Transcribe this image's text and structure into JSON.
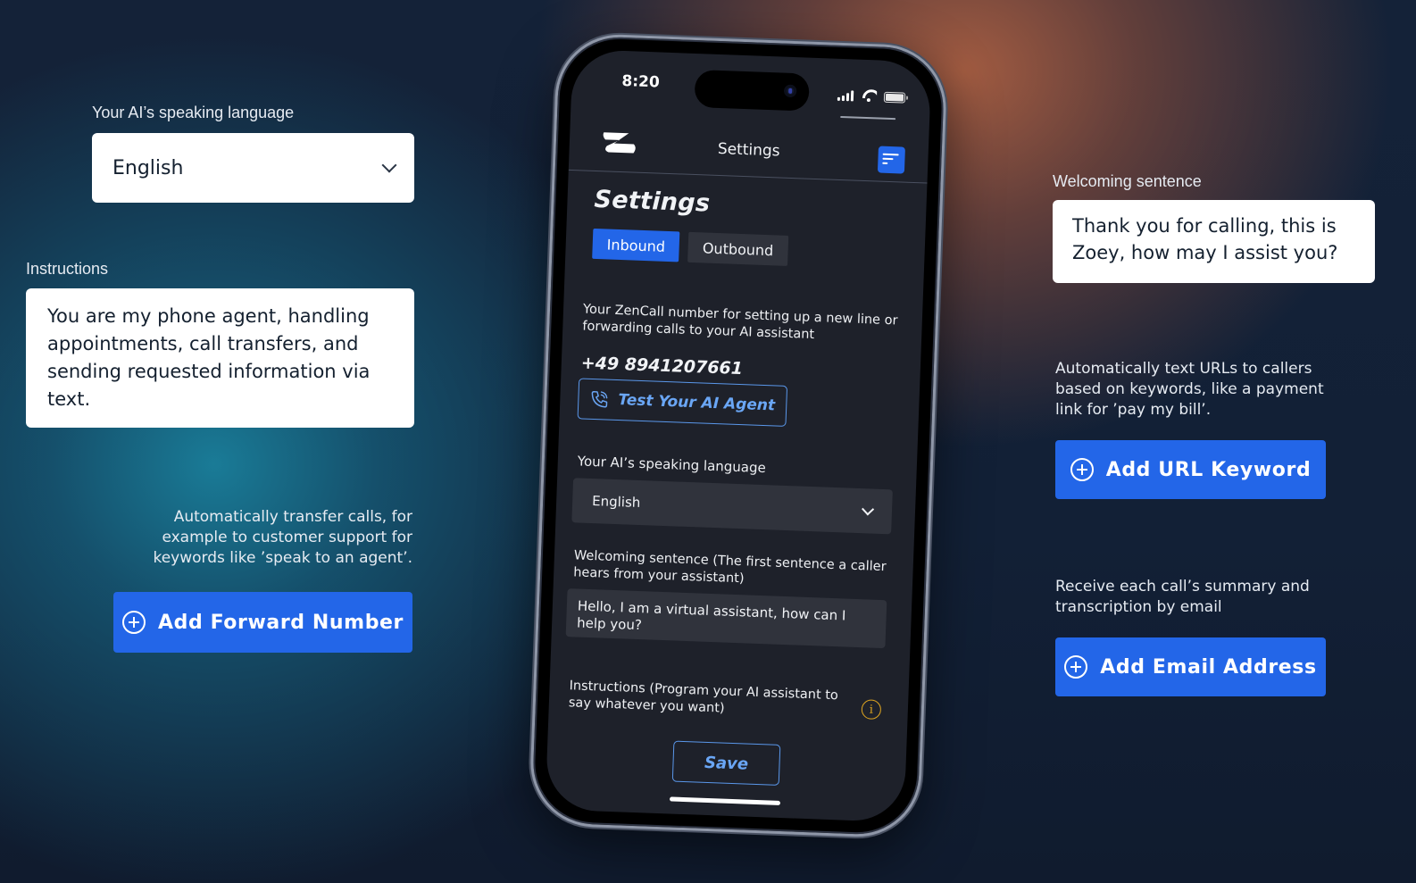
{
  "callouts": {
    "language": {
      "label": "Your AI’s speaking language",
      "value": "English"
    },
    "instructions": {
      "label": "Instructions",
      "value": "You are my phone agent, handling appointments, call transfers, and sending requested information via text."
    },
    "forward": {
      "description": "Automatically transfer calls, for example to customer support for keywords like ’speak to an agent’.",
      "button_label": "Add Forward Number"
    },
    "welcoming": {
      "label": "Welcoming sentence",
      "value": "Thank you for calling, this is Zoey, how may I assist you?"
    },
    "url_keyword": {
      "description": "Automatically text URLs to callers based on keywords, like a payment link for ’pay my bill’.",
      "button_label": "Add URL Keyword"
    },
    "email": {
      "description": "Receive each call’s summary and transcription by email",
      "button_label": "Add Email Address"
    }
  },
  "phone": {
    "status_bar": {
      "time": "8:20"
    },
    "header": {
      "title": "Settings"
    },
    "page_title": "Settings",
    "tabs": [
      {
        "label": "Inbound",
        "active": true
      },
      {
        "label": "Outbound",
        "active": false
      }
    ],
    "zencall_description": "Your ZenCall number for setting up a new line or forwarding calls to your AI assistant",
    "phone_number": "+49 8941207661",
    "test_button_label": "Test Your AI Agent",
    "language_label": "Your AI’s speaking language",
    "language_value": "English",
    "welcoming_label": "Welcoming sentence (The first sentence a caller hears from your assistant)",
    "welcoming_value": "Hello, I am a virtual assistant, how can I help you?",
    "instructions_label": "Instructions (Program your AI assistant to say whatever you want)",
    "save_label": "Save"
  },
  "colors": {
    "accent": "#2366e8",
    "outline_accent": "#5a97ea",
    "info": "#e0a620",
    "screen_bg": "#1e212a"
  }
}
